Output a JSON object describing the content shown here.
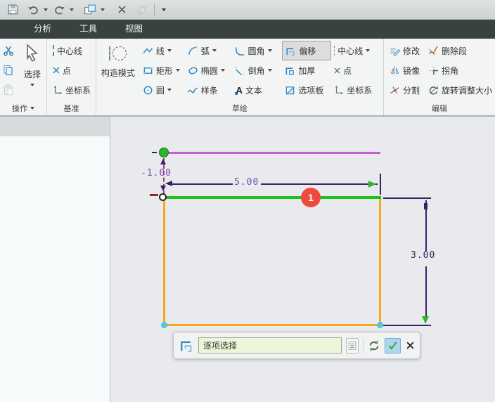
{
  "quick_access": {
    "icons": [
      "save-icon",
      "undo-icon",
      "redo-icon",
      "arrange-windows-icon",
      "close-icon",
      "duplicate-icon",
      "more-commands-icon"
    ]
  },
  "tabs": [
    {
      "label": "分析"
    },
    {
      "label": "工具"
    },
    {
      "label": "视图"
    }
  ],
  "ribbon": {
    "operations": {
      "group_label": "操作",
      "select_label": "选择"
    },
    "datum": {
      "group_label": "基准",
      "centerline": "中心线",
      "point": "点",
      "csys": "坐标系"
    },
    "sketch": {
      "group_label": "草绘",
      "construction": "构造模式",
      "line": "线",
      "rect": "矩形",
      "circle": "圆",
      "arc": "弧",
      "ellipse": "椭圆",
      "spline": "样条",
      "fillet": "圆角",
      "chamfer": "倒角",
      "text": "文本",
      "text_icon_glyph": "A",
      "offset": "偏移",
      "thicken": "加厚",
      "palette": "选项板",
      "centerline2": "中心线",
      "point2": "点",
      "csys2": "坐标系"
    },
    "edit": {
      "group_label": "编辑",
      "modify": "修改",
      "mirror": "镜像",
      "divide": "分割",
      "delete_segment": "删除段",
      "corner": "拐角",
      "rotate_resize": "旋转调整大小"
    }
  },
  "sketch_canvas": {
    "dim_offset": "-1.00",
    "dim_width": "5.00",
    "dim_height": "3.00",
    "badge": "1",
    "colors": {
      "offset_line": "#c45fd2",
      "selected_line": "#1fc11f",
      "rect_line": "#f6a81f",
      "dim_line": "#3a2063",
      "dim_text": "#7a4bb0",
      "badge_bg": "#f2493d",
      "vertex": "#49c8e8"
    }
  },
  "bottom_toolbar": {
    "input_value": "逐项选择"
  }
}
